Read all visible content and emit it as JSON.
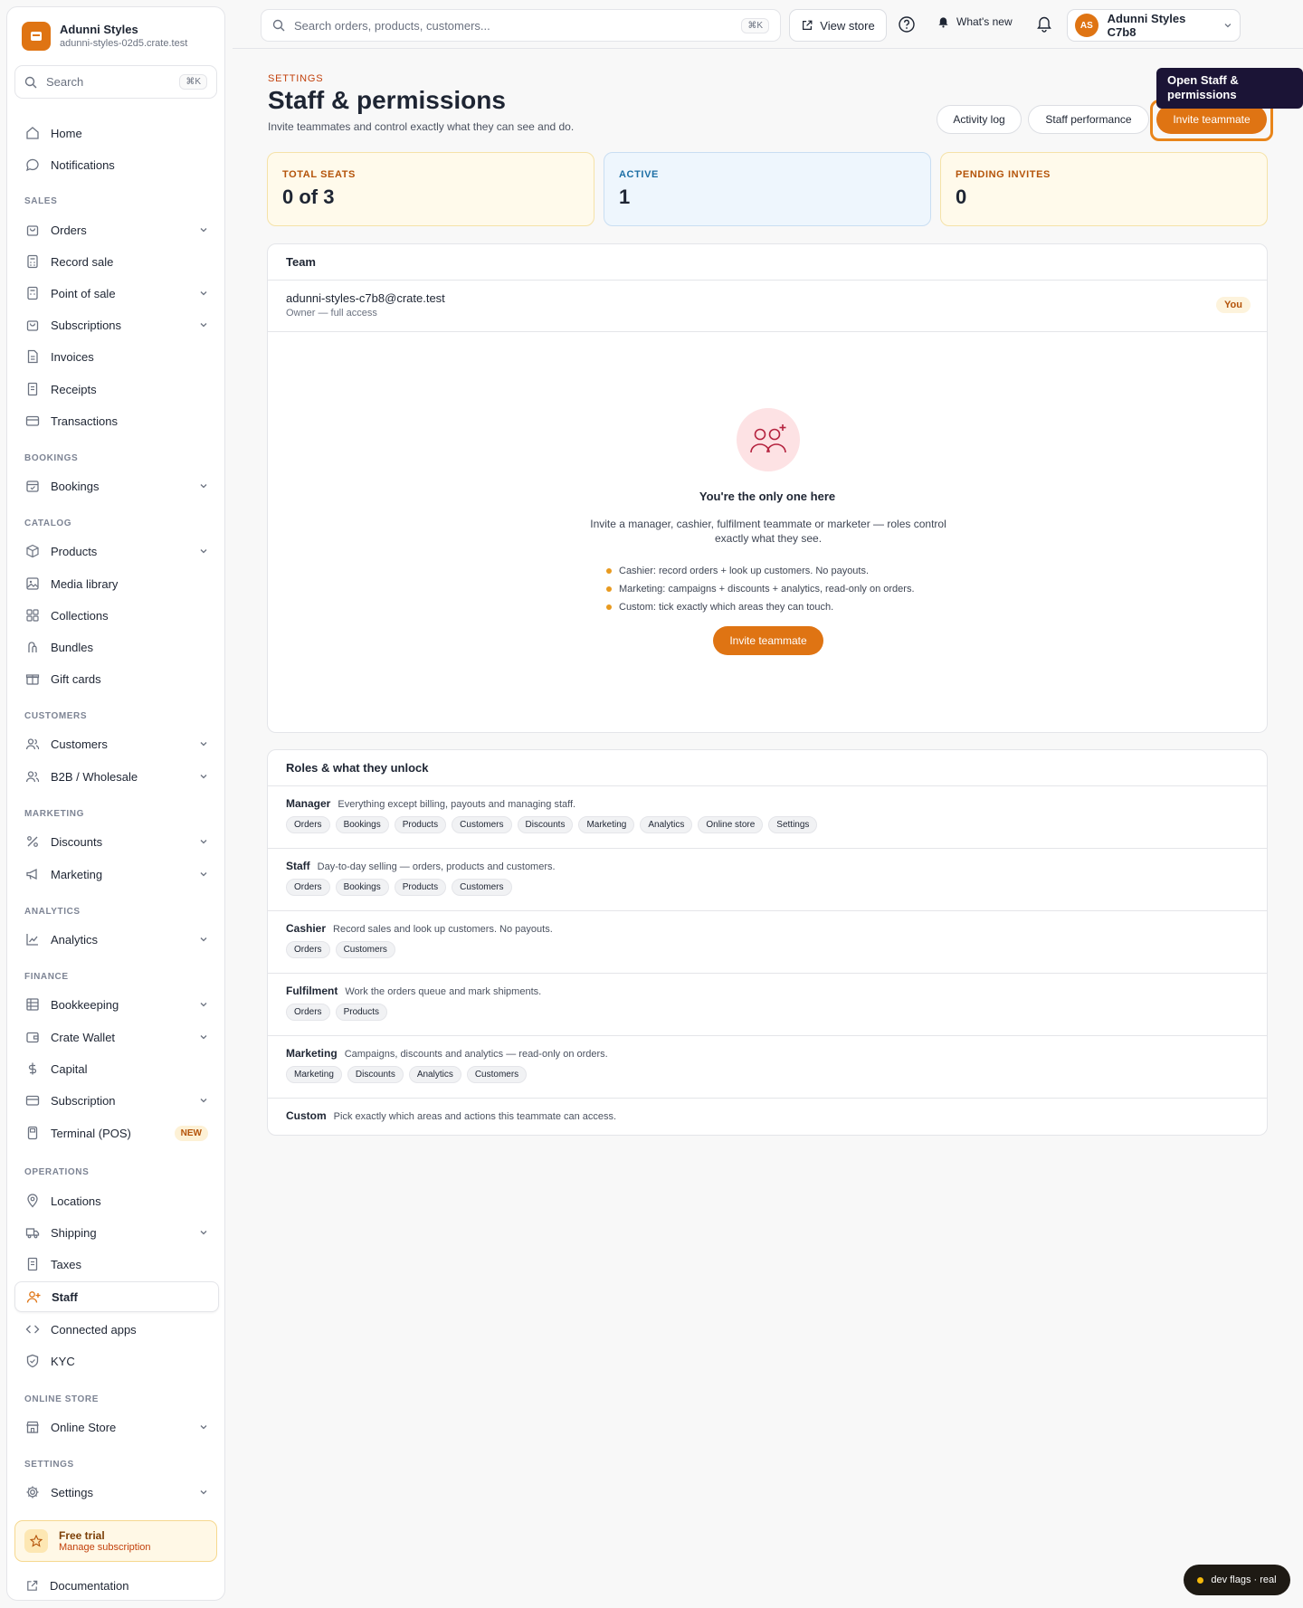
{
  "brand": {
    "name": "Adunni Styles",
    "domain": "adunni-styles-02d5.crate.test"
  },
  "sidebar_search": {
    "placeholder": "Search",
    "shortcut": "⌘K"
  },
  "nav": {
    "home": "Home",
    "notifications": "Notifications",
    "sec_sales": "SALES",
    "orders": "Orders",
    "record_sale": "Record sale",
    "point_of_sale": "Point of sale",
    "subscriptions": "Subscriptions",
    "invoices": "Invoices",
    "receipts": "Receipts",
    "transactions": "Transactions",
    "sec_bookings": "BOOKINGS",
    "bookings": "Bookings",
    "sec_catalog": "CATALOG",
    "products": "Products",
    "media_library": "Media library",
    "collections": "Collections",
    "bundles": "Bundles",
    "gift_cards": "Gift cards",
    "sec_customers": "CUSTOMERS",
    "customers": "Customers",
    "b2b": "B2B / Wholesale",
    "sec_marketing": "MARKETING",
    "discounts": "Discounts",
    "marketing": "Marketing",
    "sec_analytics": "ANALYTICS",
    "analytics": "Analytics",
    "sec_finance": "FINANCE",
    "bookkeeping": "Bookkeeping",
    "crate_wallet": "Crate Wallet",
    "capital": "Capital",
    "subscription": "Subscription",
    "terminal": "Terminal (POS)",
    "terminal_badge": "NEW",
    "sec_operations": "OPERATIONS",
    "locations": "Locations",
    "shipping": "Shipping",
    "taxes": "Taxes",
    "staff": "Staff",
    "connected_apps": "Connected apps",
    "kyc": "KYC",
    "sec_online_store": "ONLINE STORE",
    "online_store": "Online Store",
    "sec_settings": "SETTINGS",
    "settings": "Settings"
  },
  "trial": {
    "title": "Free trial",
    "link": "Manage subscription"
  },
  "documentation": "Documentation",
  "topbar": {
    "search_placeholder": "Search orders, products, customers...",
    "search_shortcut": "⌘K",
    "view_store": "View store",
    "whats_new": "What's new",
    "account_initials": "AS",
    "account_name": "Adunni Styles C7b8"
  },
  "page": {
    "eyebrow": "SETTINGS",
    "title": "Staff & permissions",
    "subtitle": "Invite teammates and control exactly what they can see and do.",
    "activity_log": "Activity log",
    "staff_performance": "Staff performance",
    "invite": "Invite teammate",
    "tooltip": "Open Staff & permissions"
  },
  "stats": [
    {
      "label": "TOTAL SEATS",
      "value": "0 of 3",
      "bg": "#fffaeb",
      "border": "#f5e2a8",
      "color": "#b45309"
    },
    {
      "label": "ACTIVE",
      "value": "1",
      "bg": "#eef6fd",
      "border": "#c9def2",
      "color": "#1d6fa5"
    },
    {
      "label": "PENDING INVITES",
      "value": "0",
      "bg": "#fffaeb",
      "border": "#f5e2a8",
      "color": "#b45309"
    }
  ],
  "team": {
    "heading": "Team",
    "member_email": "adunni-styles-c7b8@crate.test",
    "member_role": "Owner — full access",
    "you_badge": "You",
    "empty_title": "You're the only one here",
    "empty_desc": "Invite a manager, cashier, fulfilment teammate or marketer — roles control exactly what they see.",
    "bullets": [
      "Cashier: record orders + look up customers. No payouts.",
      "Marketing: campaigns + discounts + analytics, read-only on orders.",
      "Custom: tick exactly which areas they can touch."
    ],
    "empty_button": "Invite teammate"
  },
  "roles": {
    "heading": "Roles & what they unlock",
    "items": [
      {
        "name": "Manager",
        "desc": "Everything except billing, payouts and managing staff.",
        "chips": [
          "Orders",
          "Bookings",
          "Products",
          "Customers",
          "Discounts",
          "Marketing",
          "Analytics",
          "Online store",
          "Settings"
        ]
      },
      {
        "name": "Staff",
        "desc": "Day-to-day selling — orders, products and customers.",
        "chips": [
          "Orders",
          "Bookings",
          "Products",
          "Customers"
        ]
      },
      {
        "name": "Cashier",
        "desc": "Record sales and look up customers. No payouts.",
        "chips": [
          "Orders",
          "Customers"
        ]
      },
      {
        "name": "Fulfilment",
        "desc": "Work the orders queue and mark shipments.",
        "chips": [
          "Orders",
          "Products"
        ]
      },
      {
        "name": "Marketing",
        "desc": "Campaigns, discounts and analytics — read-only on orders.",
        "chips": [
          "Marketing",
          "Discounts",
          "Analytics",
          "Customers"
        ]
      },
      {
        "name": "Custom",
        "desc": "Pick exactly which areas and actions this teammate can access.",
        "chips": []
      }
    ]
  },
  "dev_flags": "dev flags · real",
  "colors": {
    "accent": "#df7413",
    "tooltip_bg": "#1b1436"
  }
}
